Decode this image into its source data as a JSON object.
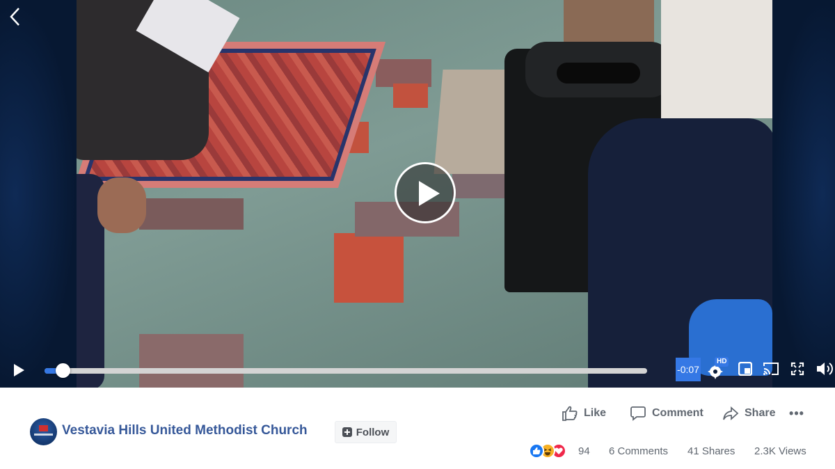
{
  "player": {
    "time_remaining": "-0:07",
    "quality_badge": "HD",
    "progress": 0.03
  },
  "icons": {
    "back": "chevron-left-icon",
    "play": "play-icon",
    "settings": "gear-icon",
    "pip": "picture-in-picture-icon",
    "cast": "cast-icon",
    "fullscreen": "fullscreen-icon",
    "volume": "volume-icon"
  },
  "actions": {
    "like_label": "Like",
    "comment_label": "Comment",
    "share_label": "Share",
    "more": "•••"
  },
  "page": {
    "name": "Vestavia Hills United Methodist Church",
    "follow_label": "Follow"
  },
  "stats": {
    "reactions_count": "94",
    "comments": "6 Comments",
    "shares": "41 Shares",
    "views": "2.3K Views"
  },
  "colors": {
    "accent": "#3578e5",
    "page_link": "#365899",
    "muted_text": "#606770",
    "like_reaction": "#1877f2",
    "haha_reaction": "#f7b125",
    "love_reaction": "#f0284a"
  }
}
